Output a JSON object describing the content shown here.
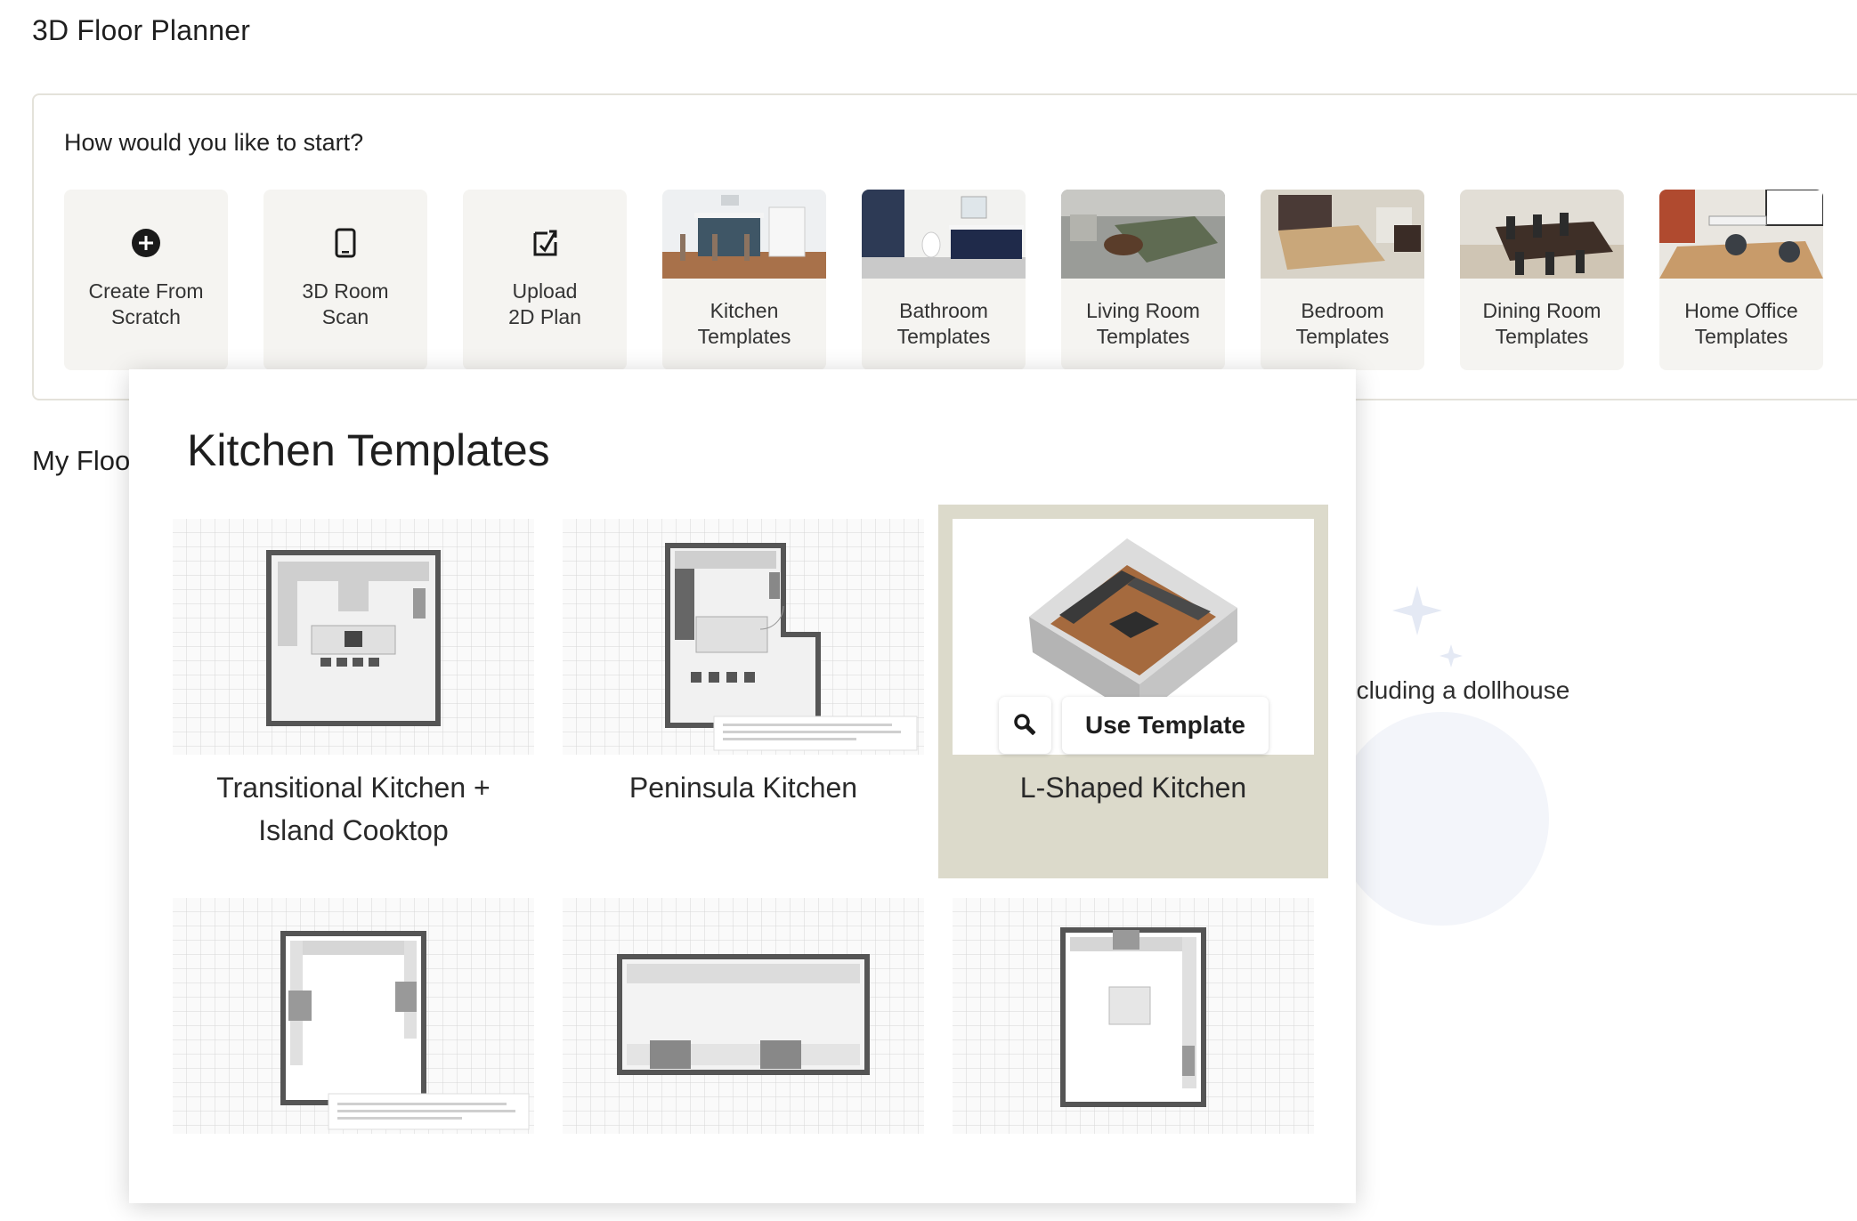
{
  "app": {
    "title": "3D Floor Planner"
  },
  "start_section": {
    "heading": "How would you like to start?",
    "options": [
      {
        "label": "Create From\nScratch",
        "icon": "plus-circle-icon"
      },
      {
        "label": "3D Room\nScan",
        "icon": "phone-icon"
      },
      {
        "label": "Upload\n2D Plan",
        "icon": "upload-plan-icon"
      },
      {
        "label": "Kitchen\nTemplates",
        "icon": "kitchen-thumbnail"
      },
      {
        "label": "Bathroom\nTemplates",
        "icon": "bathroom-thumbnail"
      },
      {
        "label": "Living Room\nTemplates",
        "icon": "living-room-thumbnail"
      },
      {
        "label": "Bedroom\nTemplates",
        "icon": "bedroom-thumbnail"
      },
      {
        "label": "Dining Room\nTemplates",
        "icon": "dining-room-thumbnail"
      },
      {
        "label": "Home Office\nTemplates",
        "icon": "home-office-thumbnail"
      }
    ]
  },
  "my_floor_plans": {
    "title_visible": "My Floo",
    "empty_text_visible": "ncluding a dollhouse"
  },
  "kitchen_overlay": {
    "title": "Kitchen Templates",
    "templates": [
      {
        "name": "Transitional Kitchen +\nIsland Cooktop",
        "selected": false
      },
      {
        "name": "Peninsula Kitchen",
        "selected": false
      },
      {
        "name": "L-Shaped Kitchen",
        "selected": true
      },
      {
        "name": "",
        "selected": false
      },
      {
        "name": "",
        "selected": false
      },
      {
        "name": "",
        "selected": false
      }
    ],
    "use_template_label": "Use Template",
    "search_icon": "magnifier-icon"
  },
  "colors": {
    "card_bg": "#f5f4f1",
    "selected_bg": "#dcdacb",
    "panel_border": "#e4e2da",
    "grid_line": "#d6d6d6",
    "wall": "#555555"
  }
}
